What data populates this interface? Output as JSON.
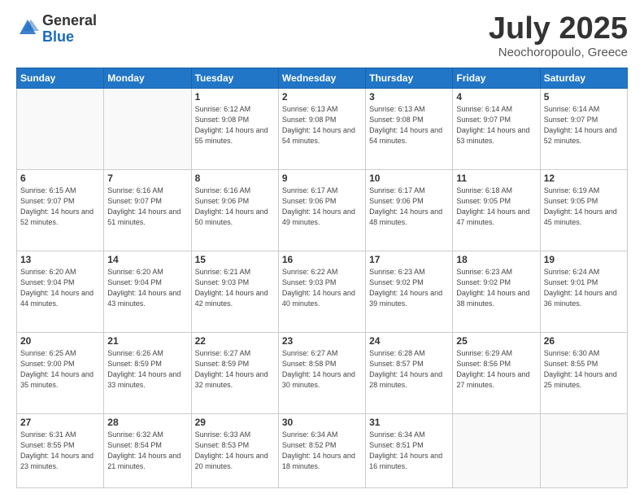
{
  "logo": {
    "general": "General",
    "blue": "Blue"
  },
  "header": {
    "month": "July 2025",
    "location": "Neochoropoulo, Greece"
  },
  "weekdays": [
    "Sunday",
    "Monday",
    "Tuesday",
    "Wednesday",
    "Thursday",
    "Friday",
    "Saturday"
  ],
  "weeks": [
    [
      {
        "day": "",
        "info": ""
      },
      {
        "day": "",
        "info": ""
      },
      {
        "day": "1",
        "info": "Sunrise: 6:12 AM\nSunset: 9:08 PM\nDaylight: 14 hours and 55 minutes."
      },
      {
        "day": "2",
        "info": "Sunrise: 6:13 AM\nSunset: 9:08 PM\nDaylight: 14 hours and 54 minutes."
      },
      {
        "day": "3",
        "info": "Sunrise: 6:13 AM\nSunset: 9:08 PM\nDaylight: 14 hours and 54 minutes."
      },
      {
        "day": "4",
        "info": "Sunrise: 6:14 AM\nSunset: 9:07 PM\nDaylight: 14 hours and 53 minutes."
      },
      {
        "day": "5",
        "info": "Sunrise: 6:14 AM\nSunset: 9:07 PM\nDaylight: 14 hours and 52 minutes."
      }
    ],
    [
      {
        "day": "6",
        "info": "Sunrise: 6:15 AM\nSunset: 9:07 PM\nDaylight: 14 hours and 52 minutes."
      },
      {
        "day": "7",
        "info": "Sunrise: 6:16 AM\nSunset: 9:07 PM\nDaylight: 14 hours and 51 minutes."
      },
      {
        "day": "8",
        "info": "Sunrise: 6:16 AM\nSunset: 9:06 PM\nDaylight: 14 hours and 50 minutes."
      },
      {
        "day": "9",
        "info": "Sunrise: 6:17 AM\nSunset: 9:06 PM\nDaylight: 14 hours and 49 minutes."
      },
      {
        "day": "10",
        "info": "Sunrise: 6:17 AM\nSunset: 9:06 PM\nDaylight: 14 hours and 48 minutes."
      },
      {
        "day": "11",
        "info": "Sunrise: 6:18 AM\nSunset: 9:05 PM\nDaylight: 14 hours and 47 minutes."
      },
      {
        "day": "12",
        "info": "Sunrise: 6:19 AM\nSunset: 9:05 PM\nDaylight: 14 hours and 45 minutes."
      }
    ],
    [
      {
        "day": "13",
        "info": "Sunrise: 6:20 AM\nSunset: 9:04 PM\nDaylight: 14 hours and 44 minutes."
      },
      {
        "day": "14",
        "info": "Sunrise: 6:20 AM\nSunset: 9:04 PM\nDaylight: 14 hours and 43 minutes."
      },
      {
        "day": "15",
        "info": "Sunrise: 6:21 AM\nSunset: 9:03 PM\nDaylight: 14 hours and 42 minutes."
      },
      {
        "day": "16",
        "info": "Sunrise: 6:22 AM\nSunset: 9:03 PM\nDaylight: 14 hours and 40 minutes."
      },
      {
        "day": "17",
        "info": "Sunrise: 6:23 AM\nSunset: 9:02 PM\nDaylight: 14 hours and 39 minutes."
      },
      {
        "day": "18",
        "info": "Sunrise: 6:23 AM\nSunset: 9:02 PM\nDaylight: 14 hours and 38 minutes."
      },
      {
        "day": "19",
        "info": "Sunrise: 6:24 AM\nSunset: 9:01 PM\nDaylight: 14 hours and 36 minutes."
      }
    ],
    [
      {
        "day": "20",
        "info": "Sunrise: 6:25 AM\nSunset: 9:00 PM\nDaylight: 14 hours and 35 minutes."
      },
      {
        "day": "21",
        "info": "Sunrise: 6:26 AM\nSunset: 8:59 PM\nDaylight: 14 hours and 33 minutes."
      },
      {
        "day": "22",
        "info": "Sunrise: 6:27 AM\nSunset: 8:59 PM\nDaylight: 14 hours and 32 minutes."
      },
      {
        "day": "23",
        "info": "Sunrise: 6:27 AM\nSunset: 8:58 PM\nDaylight: 14 hours and 30 minutes."
      },
      {
        "day": "24",
        "info": "Sunrise: 6:28 AM\nSunset: 8:57 PM\nDaylight: 14 hours and 28 minutes."
      },
      {
        "day": "25",
        "info": "Sunrise: 6:29 AM\nSunset: 8:56 PM\nDaylight: 14 hours and 27 minutes."
      },
      {
        "day": "26",
        "info": "Sunrise: 6:30 AM\nSunset: 8:55 PM\nDaylight: 14 hours and 25 minutes."
      }
    ],
    [
      {
        "day": "27",
        "info": "Sunrise: 6:31 AM\nSunset: 8:55 PM\nDaylight: 14 hours and 23 minutes."
      },
      {
        "day": "28",
        "info": "Sunrise: 6:32 AM\nSunset: 8:54 PM\nDaylight: 14 hours and 21 minutes."
      },
      {
        "day": "29",
        "info": "Sunrise: 6:33 AM\nSunset: 8:53 PM\nDaylight: 14 hours and 20 minutes."
      },
      {
        "day": "30",
        "info": "Sunrise: 6:34 AM\nSunset: 8:52 PM\nDaylight: 14 hours and 18 minutes."
      },
      {
        "day": "31",
        "info": "Sunrise: 6:34 AM\nSunset: 8:51 PM\nDaylight: 14 hours and 16 minutes."
      },
      {
        "day": "",
        "info": ""
      },
      {
        "day": "",
        "info": ""
      }
    ]
  ]
}
